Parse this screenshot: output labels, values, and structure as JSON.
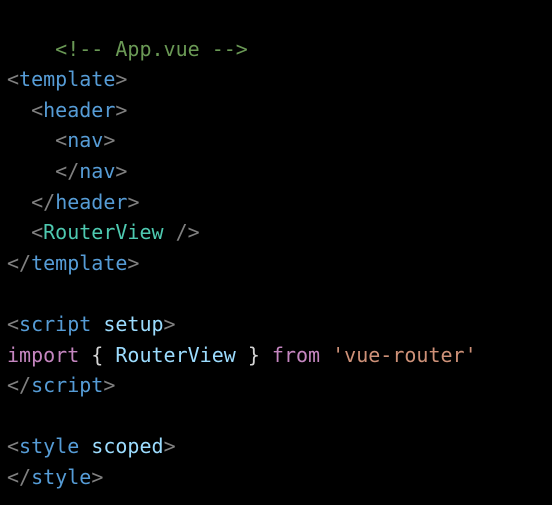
{
  "colors": {
    "background": "#000000",
    "comment": "#6a9955",
    "punctuation": "#808080",
    "tag": "#569cd6",
    "component": "#4ec9b0",
    "attribute": "#9cdcfe",
    "keyword": "#c586c0",
    "identifier": "#9cdcfe",
    "string": "#ce9178",
    "default": "#d4d4d4"
  },
  "code": {
    "l1": {
      "comment": "<!-- App.vue -->"
    },
    "l3": {
      "open": "<",
      "tag": "template",
      "close": ">"
    },
    "l4": {
      "indent": "  ",
      "open": "<",
      "tag": "header",
      "close": ">"
    },
    "l5": {
      "indent": "    ",
      "open": "<",
      "tag": "nav",
      "close": ">"
    },
    "l6": {
      "indent": "    ",
      "open": "</",
      "tag": "nav",
      "close": ">"
    },
    "l7": {
      "indent": "  ",
      "open": "</",
      "tag": "header",
      "close": ">"
    },
    "l8": {
      "indent": "  ",
      "open": "<",
      "tag": "RouterView",
      "close": " />"
    },
    "l9": {
      "open": "</",
      "tag": "template",
      "close": ">"
    },
    "l11": {
      "open": "<",
      "tag": "script",
      "attr": " setup",
      "close": ">"
    },
    "l12": {
      "kw_import": "import",
      "brace_open": " { ",
      "name": "RouterView",
      "brace_close": " } ",
      "kw_from": "from",
      "space": " ",
      "string": "'vue-router'"
    },
    "l13": {
      "open": "</",
      "tag": "script",
      "close": ">"
    },
    "l15": {
      "open": "<",
      "tag": "style",
      "attr": " scoped",
      "close": ">"
    },
    "l16": {
      "open": "</",
      "tag": "style",
      "close": ">"
    }
  }
}
